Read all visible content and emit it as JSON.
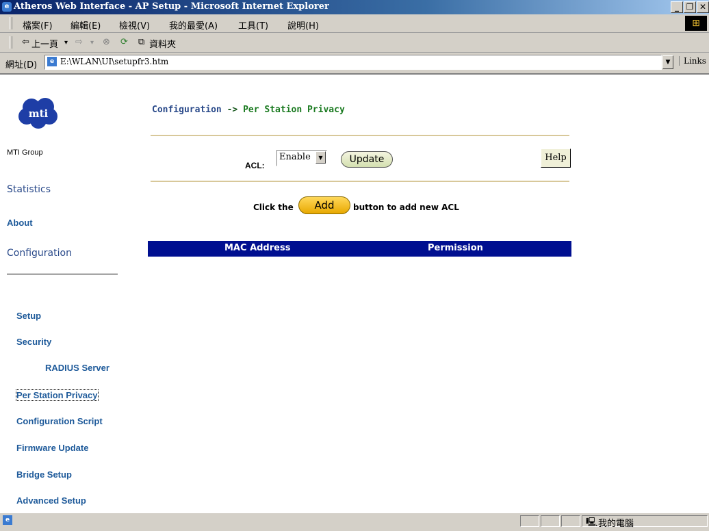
{
  "window": {
    "title": "Atheros Web Interface - AP Setup - Microsoft Internet Explorer",
    "controls": [
      "_",
      "Ɖ",
      "×"
    ]
  },
  "menu": [
    "檔案(F)",
    "編輯(E)",
    "檢視(V)",
    "我的最愛(A)",
    "工具(T)",
    "說明(H)"
  ],
  "toolbar": {
    "back_label": "上一頁",
    "folders_label": "資料夾"
  },
  "address": {
    "label": "網址(D)",
    "url": "E:\\WLAN\\UI\\setupfr3.htm",
    "links_label": "Links"
  },
  "sidebar": {
    "logo_caption": "MTI Group",
    "top_links": [
      "Statistics",
      "About",
      "Configuration"
    ],
    "links": [
      "Setup",
      "Security",
      "RADIUS Server",
      "Per Station Privacy",
      "Configuration Script",
      "Firmware Update",
      "Bridge Setup",
      "Advanced Setup"
    ]
  },
  "main": {
    "breadcrumb_section": "Configuration",
    "breadcrumb_arrow": "->",
    "breadcrumb_page": "Per Station Privacy",
    "acl_label": "ACL:",
    "acl_value": "Enable",
    "update_label": "Update",
    "help_label": "Help",
    "click_prefix": "Click the",
    "add_label": "Add",
    "click_suffix": "button to add new ACL",
    "table_headers": [
      "MAC Address",
      "Permission"
    ]
  },
  "statusbar": {
    "zone": "我的電腦"
  }
}
